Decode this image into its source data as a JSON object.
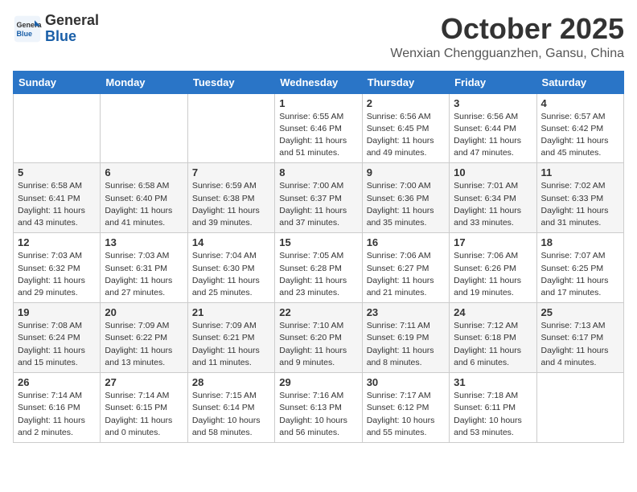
{
  "header": {
    "logo_line1": "General",
    "logo_line2": "Blue",
    "month": "October 2025",
    "location": "Wenxian Chengguanzhen, Gansu, China"
  },
  "weekdays": [
    "Sunday",
    "Monday",
    "Tuesday",
    "Wednesday",
    "Thursday",
    "Friday",
    "Saturday"
  ],
  "weeks": [
    [
      {
        "day": "",
        "info": ""
      },
      {
        "day": "",
        "info": ""
      },
      {
        "day": "",
        "info": ""
      },
      {
        "day": "1",
        "info": "Sunrise: 6:55 AM\nSunset: 6:46 PM\nDaylight: 11 hours\nand 51 minutes."
      },
      {
        "day": "2",
        "info": "Sunrise: 6:56 AM\nSunset: 6:45 PM\nDaylight: 11 hours\nand 49 minutes."
      },
      {
        "day": "3",
        "info": "Sunrise: 6:56 AM\nSunset: 6:44 PM\nDaylight: 11 hours\nand 47 minutes."
      },
      {
        "day": "4",
        "info": "Sunrise: 6:57 AM\nSunset: 6:42 PM\nDaylight: 11 hours\nand 45 minutes."
      }
    ],
    [
      {
        "day": "5",
        "info": "Sunrise: 6:58 AM\nSunset: 6:41 PM\nDaylight: 11 hours\nand 43 minutes."
      },
      {
        "day": "6",
        "info": "Sunrise: 6:58 AM\nSunset: 6:40 PM\nDaylight: 11 hours\nand 41 minutes."
      },
      {
        "day": "7",
        "info": "Sunrise: 6:59 AM\nSunset: 6:38 PM\nDaylight: 11 hours\nand 39 minutes."
      },
      {
        "day": "8",
        "info": "Sunrise: 7:00 AM\nSunset: 6:37 PM\nDaylight: 11 hours\nand 37 minutes."
      },
      {
        "day": "9",
        "info": "Sunrise: 7:00 AM\nSunset: 6:36 PM\nDaylight: 11 hours\nand 35 minutes."
      },
      {
        "day": "10",
        "info": "Sunrise: 7:01 AM\nSunset: 6:34 PM\nDaylight: 11 hours\nand 33 minutes."
      },
      {
        "day": "11",
        "info": "Sunrise: 7:02 AM\nSunset: 6:33 PM\nDaylight: 11 hours\nand 31 minutes."
      }
    ],
    [
      {
        "day": "12",
        "info": "Sunrise: 7:03 AM\nSunset: 6:32 PM\nDaylight: 11 hours\nand 29 minutes."
      },
      {
        "day": "13",
        "info": "Sunrise: 7:03 AM\nSunset: 6:31 PM\nDaylight: 11 hours\nand 27 minutes."
      },
      {
        "day": "14",
        "info": "Sunrise: 7:04 AM\nSunset: 6:30 PM\nDaylight: 11 hours\nand 25 minutes."
      },
      {
        "day": "15",
        "info": "Sunrise: 7:05 AM\nSunset: 6:28 PM\nDaylight: 11 hours\nand 23 minutes."
      },
      {
        "day": "16",
        "info": "Sunrise: 7:06 AM\nSunset: 6:27 PM\nDaylight: 11 hours\nand 21 minutes."
      },
      {
        "day": "17",
        "info": "Sunrise: 7:06 AM\nSunset: 6:26 PM\nDaylight: 11 hours\nand 19 minutes."
      },
      {
        "day": "18",
        "info": "Sunrise: 7:07 AM\nSunset: 6:25 PM\nDaylight: 11 hours\nand 17 minutes."
      }
    ],
    [
      {
        "day": "19",
        "info": "Sunrise: 7:08 AM\nSunset: 6:24 PM\nDaylight: 11 hours\nand 15 minutes."
      },
      {
        "day": "20",
        "info": "Sunrise: 7:09 AM\nSunset: 6:22 PM\nDaylight: 11 hours\nand 13 minutes."
      },
      {
        "day": "21",
        "info": "Sunrise: 7:09 AM\nSunset: 6:21 PM\nDaylight: 11 hours\nand 11 minutes."
      },
      {
        "day": "22",
        "info": "Sunrise: 7:10 AM\nSunset: 6:20 PM\nDaylight: 11 hours\nand 9 minutes."
      },
      {
        "day": "23",
        "info": "Sunrise: 7:11 AM\nSunset: 6:19 PM\nDaylight: 11 hours\nand 8 minutes."
      },
      {
        "day": "24",
        "info": "Sunrise: 7:12 AM\nSunset: 6:18 PM\nDaylight: 11 hours\nand 6 minutes."
      },
      {
        "day": "25",
        "info": "Sunrise: 7:13 AM\nSunset: 6:17 PM\nDaylight: 11 hours\nand 4 minutes."
      }
    ],
    [
      {
        "day": "26",
        "info": "Sunrise: 7:14 AM\nSunset: 6:16 PM\nDaylight: 11 hours\nand 2 minutes."
      },
      {
        "day": "27",
        "info": "Sunrise: 7:14 AM\nSunset: 6:15 PM\nDaylight: 11 hours\nand 0 minutes."
      },
      {
        "day": "28",
        "info": "Sunrise: 7:15 AM\nSunset: 6:14 PM\nDaylight: 10 hours\nand 58 minutes."
      },
      {
        "day": "29",
        "info": "Sunrise: 7:16 AM\nSunset: 6:13 PM\nDaylight: 10 hours\nand 56 minutes."
      },
      {
        "day": "30",
        "info": "Sunrise: 7:17 AM\nSunset: 6:12 PM\nDaylight: 10 hours\nand 55 minutes."
      },
      {
        "day": "31",
        "info": "Sunrise: 7:18 AM\nSunset: 6:11 PM\nDaylight: 10 hours\nand 53 minutes."
      },
      {
        "day": "",
        "info": ""
      }
    ]
  ]
}
